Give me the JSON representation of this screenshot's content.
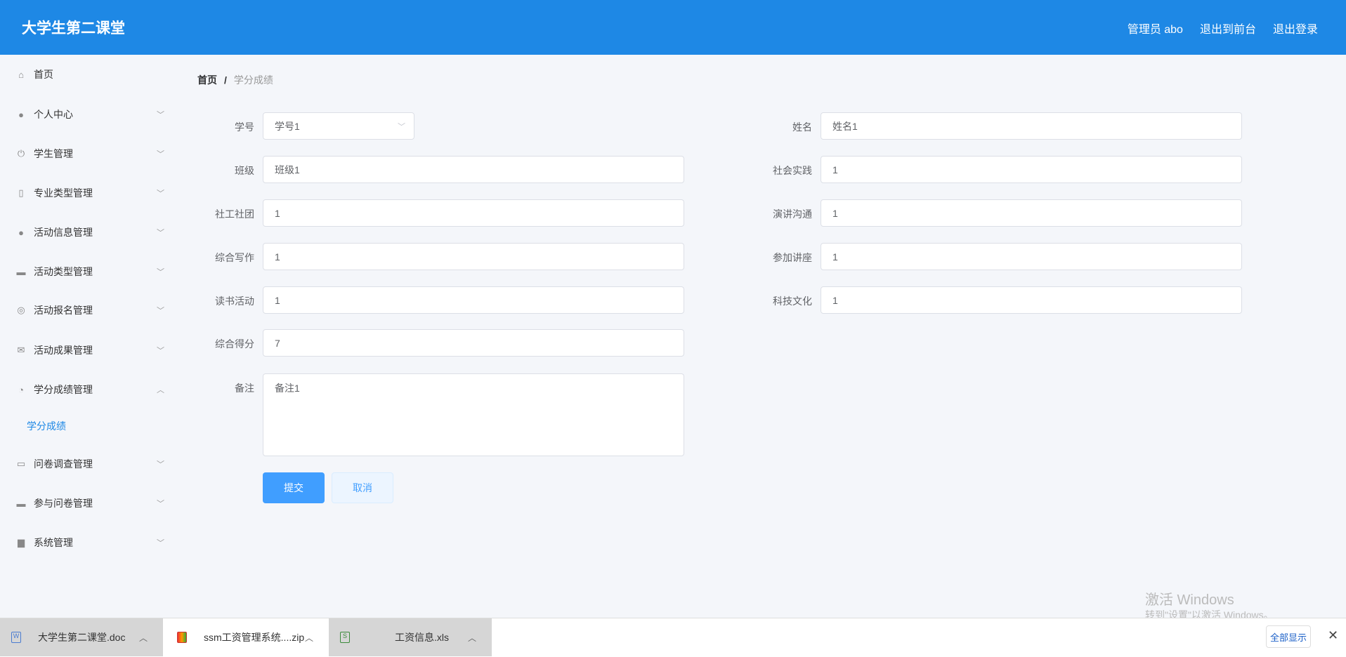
{
  "header": {
    "title": "大学生第二课堂",
    "admin": "管理员 abo",
    "to_front": "退出到前台",
    "logout": "退出登录"
  },
  "sidebar": {
    "items": [
      {
        "label": "首页",
        "icon": "home-icon"
      },
      {
        "label": "个人中心",
        "icon": "user-icon"
      },
      {
        "label": "学生管理",
        "icon": "power-icon"
      },
      {
        "label": "专业类型管理",
        "icon": "microphone-icon"
      },
      {
        "label": "活动信息管理",
        "icon": "bulb-icon"
      },
      {
        "label": "活动类型管理",
        "icon": "chat-icon"
      },
      {
        "label": "活动报名管理",
        "icon": "lifebuoy-icon"
      },
      {
        "label": "活动成果管理",
        "icon": "mail-icon"
      },
      {
        "label": "学分成绩管理",
        "icon": "gauge-icon"
      },
      {
        "label": "问卷调查管理",
        "icon": "comment-icon"
      },
      {
        "label": "参与问卷管理",
        "icon": "box-icon"
      },
      {
        "label": "系统管理",
        "icon": "briefcase-icon"
      }
    ],
    "sub_item": "学分成绩"
  },
  "breadcrumb": {
    "home": "首页",
    "sep": "/",
    "current": "学分成绩"
  },
  "form": {
    "xuehao": {
      "label": "学号",
      "value": "学号1"
    },
    "xingming": {
      "label": "姓名",
      "value": "姓名1"
    },
    "banji": {
      "label": "班级",
      "value": "班级1"
    },
    "shehuishijian": {
      "label": "社会实践",
      "value": "1"
    },
    "shegongshetuan": {
      "label": "社工社团",
      "value": "1"
    },
    "yanjiang": {
      "label": "演讲沟通",
      "value": "1"
    },
    "xiezuo": {
      "label": "综合写作",
      "value": "1"
    },
    "jiangzuo": {
      "label": "参加讲座",
      "value": "1"
    },
    "dushu": {
      "label": "读书活动",
      "value": "1"
    },
    "keji": {
      "label": "科技文化",
      "value": "1"
    },
    "defen": {
      "label": "综合得分",
      "value": "7"
    },
    "beizhu": {
      "label": "备注",
      "value": "备注1"
    },
    "submit": "提交",
    "cancel": "取消"
  },
  "downloads": {
    "items": [
      "大学生第二课堂.doc",
      "ssm工资管理系统....zip",
      "工资信息.xls"
    ],
    "show_all": "全部显示",
    "close": "✕"
  },
  "watermark": {
    "line1": "激活 Windows",
    "line2": "转到\"设置\"以激活 Windows。"
  }
}
